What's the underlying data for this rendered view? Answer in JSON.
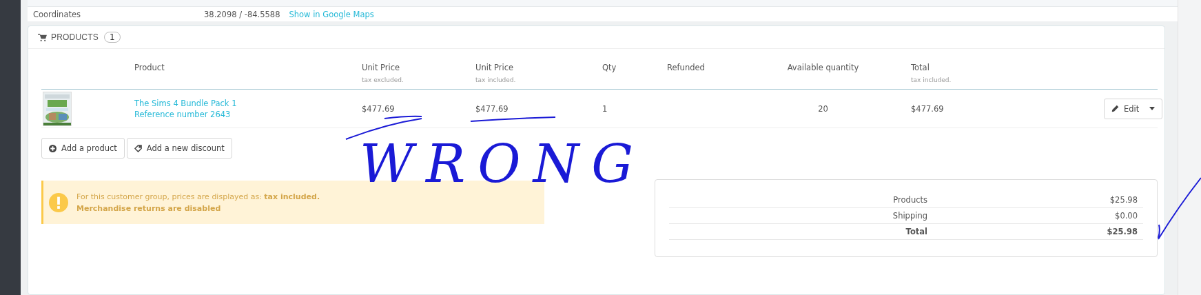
{
  "info_row": {
    "label": "Coordinates",
    "value": "38.2098 / -84.5588",
    "link": "Show in Google Maps"
  },
  "products_panel": {
    "title": "PRODUCTS",
    "count": "1",
    "columns": [
      {
        "label": "Product"
      },
      {
        "label": "Unit Price",
        "note": "tax excluded."
      },
      {
        "label": "Unit Price",
        "note": "tax included."
      },
      {
        "label": "Qty"
      },
      {
        "label": "Refunded"
      },
      {
        "label": "Available quantity"
      },
      {
        "label": "Total",
        "note": "tax included."
      }
    ],
    "rows": [
      {
        "name": "The Sims 4 Bundle Pack 1",
        "reference": "Reference number 2643",
        "unit_price_excl": "$477.69",
        "unit_price_incl": "$477.69",
        "qty": "1",
        "available": "20",
        "total": "$477.69",
        "action": "Edit"
      }
    ],
    "buttons": [
      "Add a product",
      "Add a new discount"
    ],
    "alert": {
      "text": "For this customer group, prices are displayed as: **tax included.**",
      "note": "Merchandise returns are disabled"
    },
    "totals": [
      {
        "label": "Products",
        "value": "$25.98",
        "kind": "normal"
      },
      {
        "label": "Shipping",
        "value": "$0.00",
        "kind": "normal"
      },
      {
        "label": "Total",
        "value": "$25.98",
        "kind": "bold"
      }
    ]
  },
  "annotation": {
    "text": "WRONG"
  }
}
